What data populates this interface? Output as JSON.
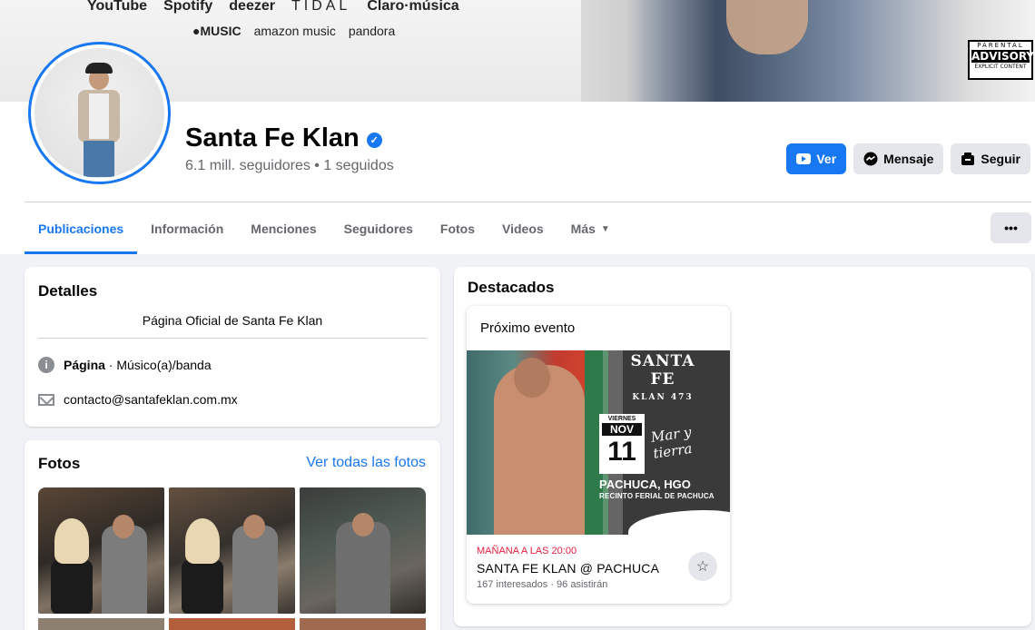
{
  "cover": {
    "platforms_row1": [
      "YouTube",
      "Spotify",
      "deezer",
      "TIDAL",
      "Claro·música"
    ],
    "platforms_row2": [
      "MUSIC",
      "amazon music",
      "pandora"
    ],
    "advisory": {
      "line1": "PARENTAL",
      "line2": "ADVISORY",
      "line3": "EXPLICIT CONTENT"
    }
  },
  "profile": {
    "name": "Santa Fe Klan",
    "stats": "6.1 mill. seguidores • 1 seguidos",
    "buttons": {
      "watch": "Ver",
      "message": "Mensaje",
      "follow": "Seguir"
    }
  },
  "tabs": [
    "Publicaciones",
    "Información",
    "Menciones",
    "Seguidores",
    "Fotos",
    "Videos",
    "Más"
  ],
  "more_label": "•••",
  "details": {
    "title": "Detalles",
    "intro": "Página Oficial de Santa Fe Klan",
    "category_label": "Página",
    "category_value": " · Músico(a)/banda",
    "email": "contacto@santafeklan.com.mx"
  },
  "photos": {
    "title": "Fotos",
    "see_all": "Ver todas las fotos"
  },
  "featured": {
    "title": "Destacados",
    "event": {
      "label": "Próximo evento",
      "poster": {
        "logo": "SANTA FE",
        "logo_sub": "KLAN 473",
        "day_name": "VIERNES",
        "month": "NOV",
        "day": "11",
        "script": "Mar y tierra",
        "city": "PACHUCA, HGO",
        "venue": "RECINTO FERIAL DE PACHUCA"
      },
      "when": "MAÑANA A LAS 20:00",
      "name": "SANTA FE KLAN @ PACHUCA",
      "stats": "167 interesados · 96 asistirán"
    }
  },
  "colors": {
    "accent": "#1877f2",
    "event_time": "#e41e3f"
  }
}
